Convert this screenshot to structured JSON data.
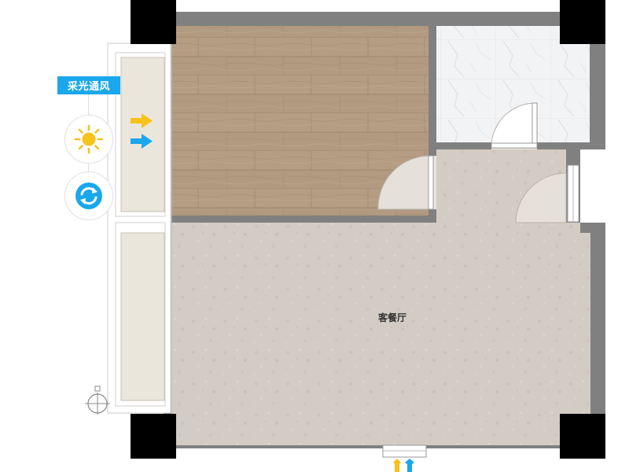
{
  "labels": {
    "ventilation_badge": "采光通风",
    "living_dining_room": "客餐厅"
  },
  "icons": {
    "sun": "sun-icon",
    "rotate": "rotate-view-icon",
    "compass": "compass-icon",
    "arrow_light": "yellow-arrow-icon",
    "arrow_air": "blue-arrow-icon"
  },
  "colors": {
    "wall": "#808080",
    "wall_pillar": "#000000",
    "wood_floor": "#b29a80",
    "stone_floor": "#d3ccc5",
    "marble_floor": "#f2f3f5",
    "balcony": "#ebe6dc",
    "badge": "#1aa7ec",
    "arrow_light": "#f7c21b",
    "arrow_air": "#1aa7ec"
  }
}
